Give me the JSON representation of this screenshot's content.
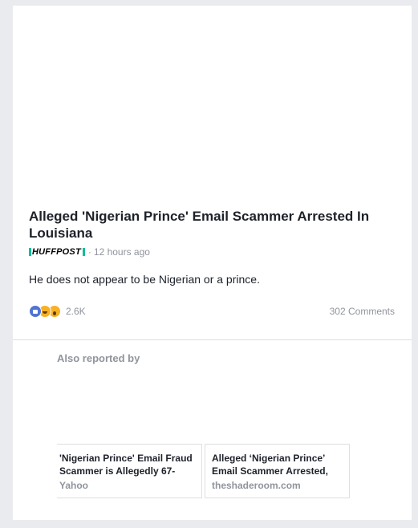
{
  "post": {
    "headline": "Alleged 'Nigerian Prince' Email Scammer Arrested In Louisiana",
    "source_logo": "HUFFPOST",
    "separator": "·",
    "time": "12 hours ago",
    "summary": "He does not appear to be Nigerian or a prince.",
    "reaction_count": "2.6K",
    "reactions": [
      "like",
      "haha",
      "wow"
    ],
    "comments": "302 Comments"
  },
  "also_reported": {
    "label": "Also reported by",
    "items": [
      {
        "title": "'Nigerian Prince' Email Fraud Scammer is Allegedly 67-",
        "source": "Yahoo"
      },
      {
        "title": "Alleged ‘Nigerian Prince’ Email Scammer Arrested,",
        "source": "theshaderoom.com"
      }
    ]
  },
  "colors": {
    "page_background": "#e9ebee",
    "card_background": "#ffffff",
    "primary_text": "#1d2129",
    "secondary_text": "#90949c",
    "like_blue": "#4f74d2",
    "huffpost_green": "#0dbe98"
  }
}
